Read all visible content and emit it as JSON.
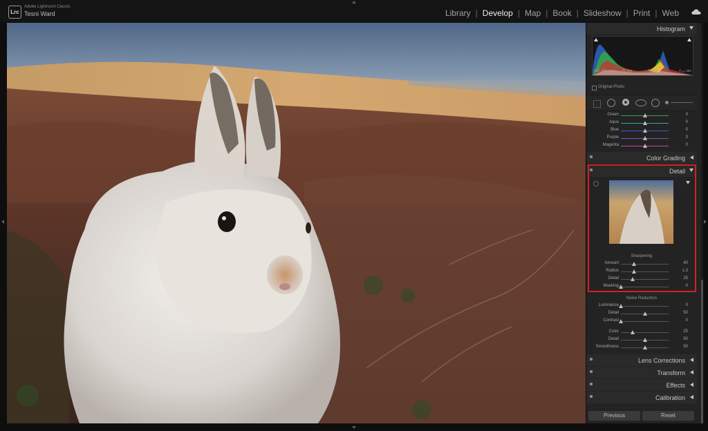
{
  "app": {
    "product_name": "Adobe Lightroom Classic",
    "logo_text": "Lrc",
    "user_name": "Tesni Ward"
  },
  "modules": [
    {
      "label": "Library",
      "active": false
    },
    {
      "label": "Develop",
      "active": true
    },
    {
      "label": "Map",
      "active": false
    },
    {
      "label": "Book",
      "active": false
    },
    {
      "label": "Slideshow",
      "active": false
    },
    {
      "label": "Print",
      "active": false
    },
    {
      "label": "Web",
      "active": false
    }
  ],
  "module_separator": "|",
  "icons": {
    "cloud": "cloud-sync-icon",
    "panel_toggle": "disclosure-triangle-icon"
  },
  "histogram": {
    "title": "Histogram",
    "iso": "ISO 320",
    "focal_length": "26 mm",
    "aperture": "ƒ / 5.0",
    "shutter": "¹⁄₀₀₀ sec",
    "original_photo_label": "Original Photo"
  },
  "hsl": {
    "rows": [
      {
        "label": "Green",
        "value": "0",
        "color": "#3fa34a"
      },
      {
        "label": "Aqua",
        "value": "0",
        "color": "#3aa6a0"
      },
      {
        "label": "Blue",
        "value": "0",
        "color": "#3d5fc4"
      },
      {
        "label": "Purple",
        "value": "0",
        "color": "#8a4ac0"
      },
      {
        "label": "Magenta",
        "value": "0",
        "color": "#c04a9a"
      }
    ]
  },
  "sections": {
    "color_grading": "Color Grading",
    "detail": "Detail",
    "lens_corrections": "Lens Corrections",
    "transform": "Transform",
    "effects": "Effects",
    "calibration": "Calibration"
  },
  "sharpening": {
    "title": "Sharpening",
    "rows": [
      {
        "label": "Amount",
        "value": "40",
        "level": 0.27
      },
      {
        "label": "Radius",
        "value": "1.3",
        "level": 0.27
      },
      {
        "label": "Detail",
        "value": "25",
        "level": 0.25
      },
      {
        "label": "Masking",
        "value": "0",
        "level": 0.0
      }
    ]
  },
  "noise_reduction": {
    "title": "Noise Reduction",
    "rows": [
      {
        "label": "Luminance",
        "value": "0",
        "level": 0.0
      },
      {
        "label": "Detail",
        "value": "50",
        "level": 0.5
      },
      {
        "label": "Contrast",
        "value": "0",
        "level": 0.0
      },
      {
        "label": "Color",
        "value": "25",
        "level": 0.25
      },
      {
        "label": "Detail",
        "value": "50",
        "level": 0.5
      },
      {
        "label": "Smoothness",
        "value": "50",
        "level": 0.5
      }
    ]
  },
  "buttons": {
    "previous": "Previous",
    "reset": "Reset"
  },
  "colors": {
    "accent_highlight": "#d42020",
    "panel_bg": "#232323",
    "header_bg": "#2a2a2a"
  }
}
